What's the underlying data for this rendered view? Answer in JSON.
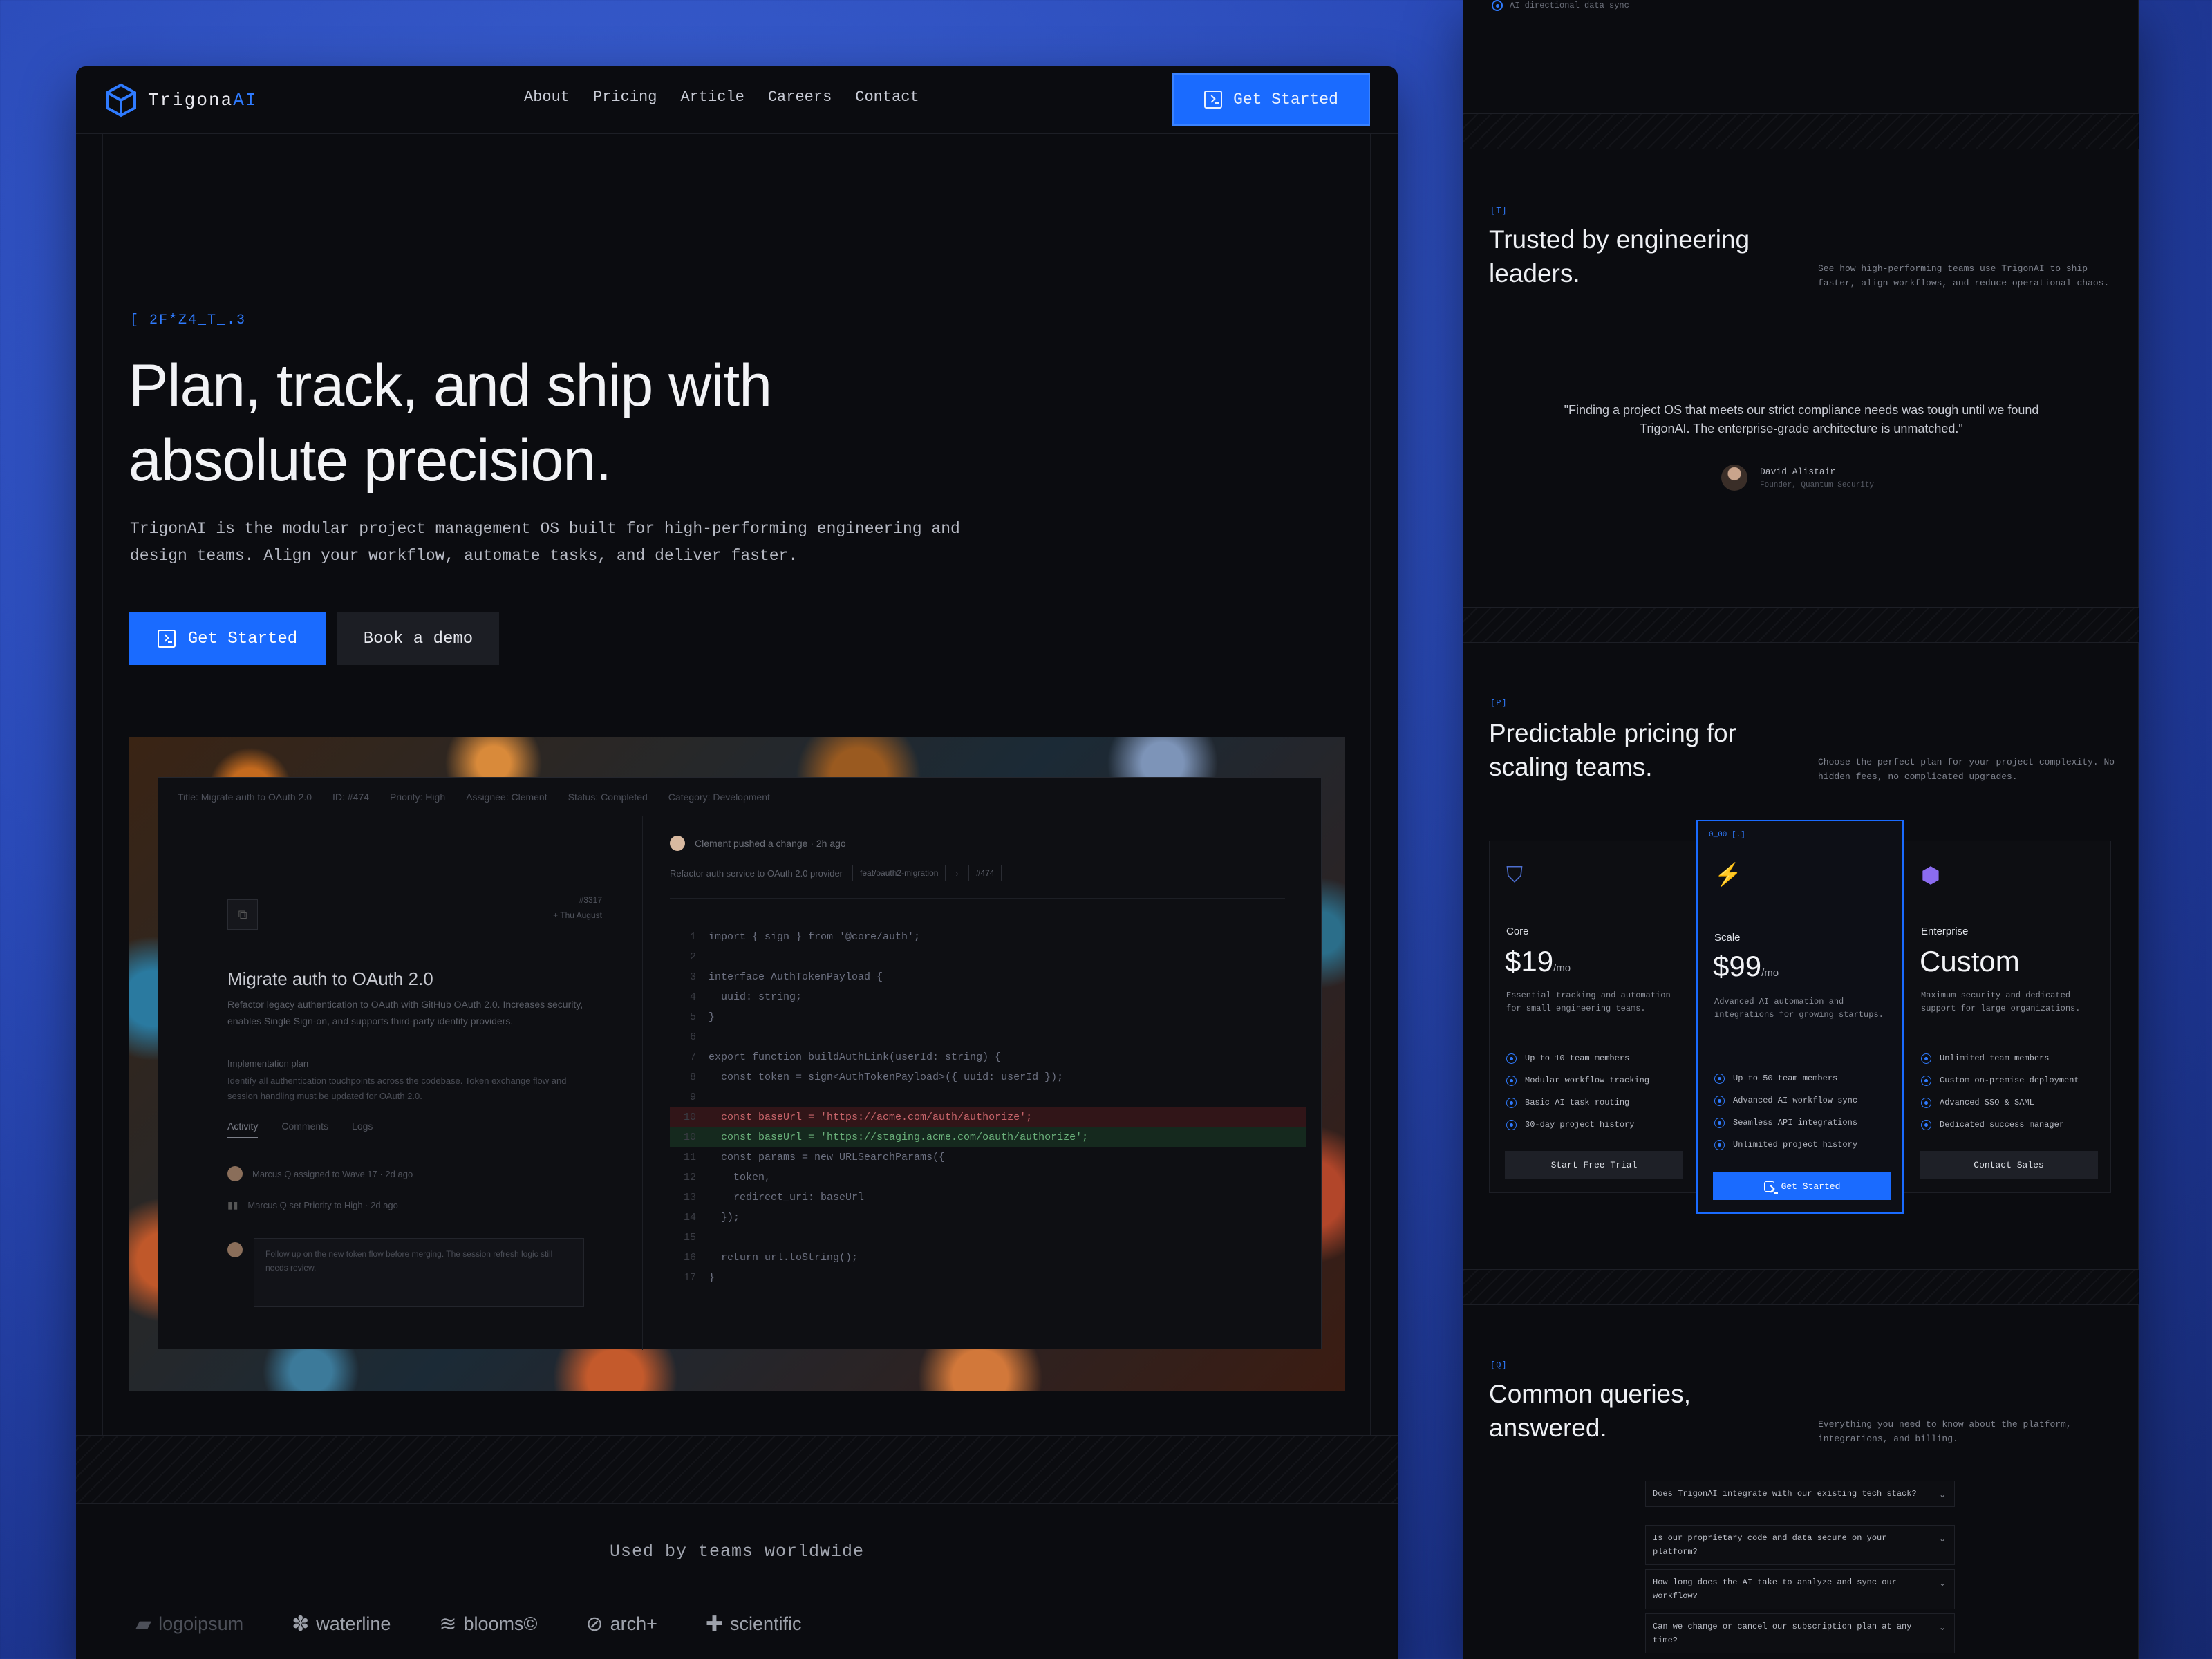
{
  "brand": {
    "name_main": "Trigona",
    "name_accent": "AI",
    "accent_color": "#1a6bff"
  },
  "nav": {
    "links": [
      "About",
      "Pricing",
      "Article",
      "Careers",
      "Contact"
    ],
    "cta_label": "Get Started"
  },
  "hero": {
    "eyebrow": "[ 2F*Z4_T_.3",
    "title_line1": "Plan, track, and ship with",
    "title_line2": "absolute precision.",
    "description": "TrigonAI is the modular project management OS built for high-performing engineering and design teams. Align your workflow, automate tasks, and deliver faster.",
    "primary_label": "Get Started",
    "secondary_label": "Book a demo"
  },
  "preview": {
    "header": [
      "Title: Migrate auth to OAuth 2.0",
      "ID: #474",
      "Priority: High",
      "Assignee: Clement",
      "Status: Completed",
      "Category: Development"
    ],
    "task_title": "Migrate auth to OAuth 2.0",
    "task_ids": [
      "#3317",
      "+ Thu August"
    ],
    "task_desc": "Refactor legacy authentication to OAuth with GitHub OAuth 2.0. Increases security, enables Single Sign-on, and supports third-party identity providers.",
    "sub_heading": "Implementation plan",
    "sub_desc": "Identify all authentication touchpoints across the codebase. Token exchange flow and session handling must be updated for OAuth 2.0.",
    "tabs": [
      "Activity",
      "Comments",
      "Logs"
    ],
    "activity": [
      "Marcus Q assigned to Wave 17 · 2d ago",
      "Marcus Q set Priority to High · 2d ago"
    ],
    "comment": "Follow up on the new token flow before merging. The session refresh logic still needs review.",
    "commit_author": "Clement pushed a change · 2h ago",
    "commit_msg": "Refactor auth service to OAuth 2.0 provider",
    "commit_chips": [
      "feat/oauth2-migration",
      "#474"
    ],
    "code": [
      {
        "n": "1",
        "t": "import { sign } from '@core/auth';",
        "k": ""
      },
      {
        "n": "2",
        "t": "",
        "k": ""
      },
      {
        "n": "3",
        "t": "interface AuthTokenPayload {",
        "k": ""
      },
      {
        "n": "4",
        "t": "  uuid: string;",
        "k": ""
      },
      {
        "n": "5",
        "t": "}",
        "k": ""
      },
      {
        "n": "6",
        "t": "",
        "k": ""
      },
      {
        "n": "7",
        "t": "export function buildAuthLink(userId: string) {",
        "k": ""
      },
      {
        "n": "8",
        "t": "  const token = sign<AuthTokenPayload>({ uuid: userId });",
        "k": ""
      },
      {
        "n": "9",
        "t": "",
        "k": ""
      },
      {
        "n": "10",
        "t": "  const baseUrl = 'https://acme.com/auth/authorize';",
        "k": "del"
      },
      {
        "n": "10",
        "t": "  const baseUrl = 'https://staging.acme.com/oauth/authorize';",
        "k": "add"
      },
      {
        "n": "11",
        "t": "  const params = new URLSearchParams({",
        "k": ""
      },
      {
        "n": "12",
        "t": "    token,",
        "k": ""
      },
      {
        "n": "13",
        "t": "    redirect_uri: baseUrl",
        "k": ""
      },
      {
        "n": "14",
        "t": "  });",
        "k": ""
      },
      {
        "n": "15",
        "t": "",
        "k": ""
      },
      {
        "n": "16",
        "t": "  return url.toString();",
        "k": ""
      },
      {
        "n": "17",
        "t": "}",
        "k": ""
      }
    ]
  },
  "used_by": {
    "label": "Used by teams worldwide",
    "logos": [
      "logoipsum",
      "waterline",
      "blooms©",
      "arch+",
      "scientific"
    ]
  },
  "right": {
    "top_item": "AI directional data sync",
    "testimonials": {
      "tag": "[T]",
      "title": "Trusted by engineering leaders.",
      "desc": "See how high-performing teams use TrigonAI to ship faster, align workflows, and reduce operational chaos.",
      "quote": "\"Finding a project OS that meets our strict compliance needs was tough until we found TrigonAI. The enterprise-grade architecture is unmatched.\"",
      "author_name": "David Alistair",
      "author_role": "Founder, Quantum Security"
    },
    "pricing": {
      "tag": "[P]",
      "title": "Predictable pricing for scaling teams.",
      "desc": "Choose the perfect plan for your project complexity. No hidden fees, no complicated upgrades.",
      "plans": [
        {
          "name": "Core",
          "price": "$19",
          "period": "/mo",
          "desc": "Essential tracking and automation for small engineering teams.",
          "features": [
            "Up to 10 team members",
            "Modular workflow tracking",
            "Basic AI task routing",
            "30-day project history"
          ],
          "cta": "Start Free Trial",
          "icon": "shield-icon"
        },
        {
          "name": "Scale",
          "price": "$99",
          "period": "/mo",
          "tag": "0_00 [.]",
          "desc": "Advanced AI automation and integrations for growing startups.",
          "features": [
            "Up to 50 team members",
            "Advanced AI workflow sync",
            "Seamless API integrations",
            "Unlimited project history"
          ],
          "cta": "Get Started",
          "icon": "lightning-icon"
        },
        {
          "name": "Enterprise",
          "price": "Custom",
          "period": "",
          "desc": "Maximum security and dedicated support for large organizations.",
          "features": [
            "Unlimited team members",
            "Custom on-premise deployment",
            "Advanced SSO & SAML",
            "Dedicated success manager"
          ],
          "cta": "Contact Sales",
          "icon": "gem-icon"
        }
      ]
    },
    "faq": {
      "tag": "[Q]",
      "title": "Common queries, answered.",
      "desc": "Everything you need to know about the platform, integrations, and billing.",
      "items": [
        "Does TrigonAI integrate with our existing tech stack?",
        "Is our proprietary code and data secure on your platform?",
        "How long does the AI take to analyze and sync our workflow?",
        "Can we change or cancel our subscription plan at any time?"
      ]
    }
  }
}
